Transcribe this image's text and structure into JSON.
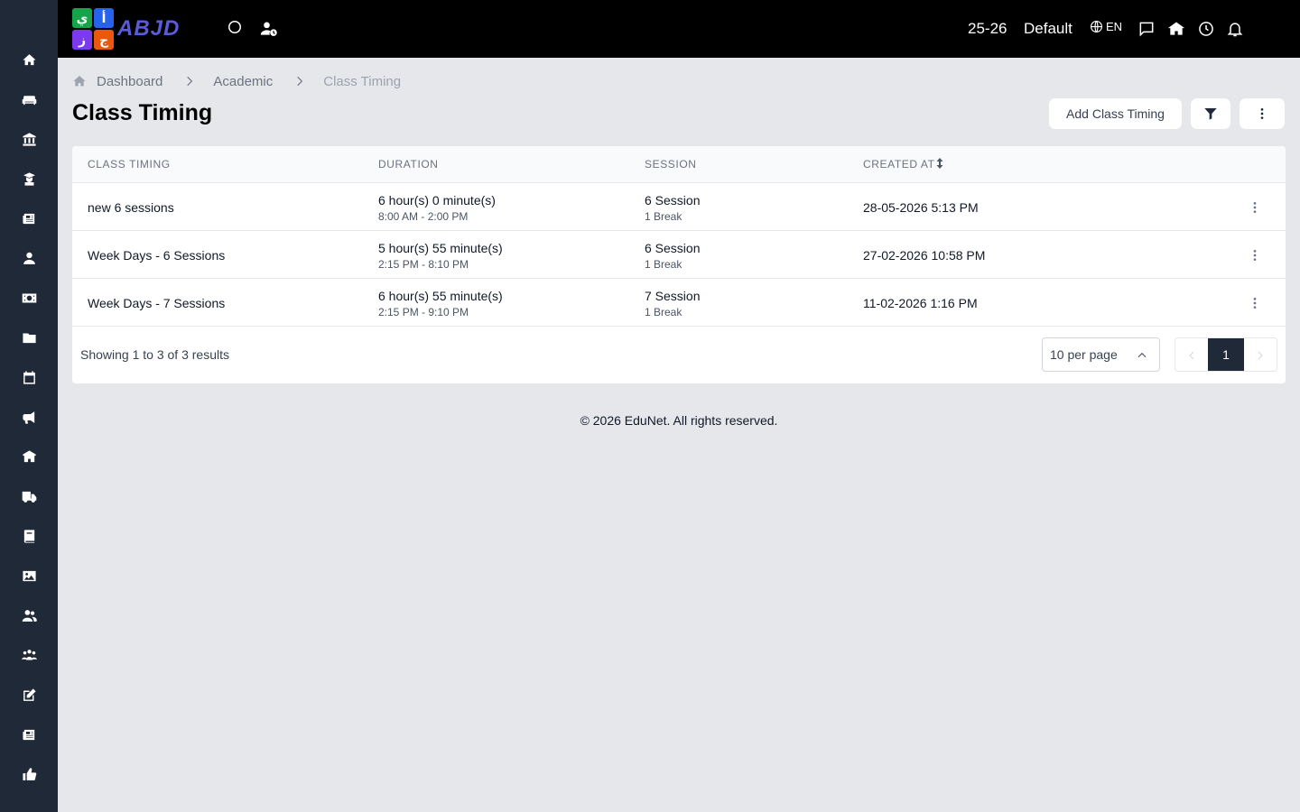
{
  "header": {
    "logo_letters": [
      "ي",
      "أ",
      "ز",
      "ج"
    ],
    "logo_colors": [
      "#16a34a",
      "#2563eb",
      "#7c3aed",
      "#ea580c"
    ],
    "logo_text": "ABJD",
    "session_year": "25-26",
    "school": "Default",
    "language": "EN",
    "icons": [
      "circle-icon",
      "user-clock-icon",
      "globe-icon",
      "chat-icon",
      "school-icon",
      "clock-icon",
      "bell-icon",
      "avatar"
    ]
  },
  "sidebar": {
    "icons": [
      "home-icon",
      "sofa-icon",
      "bank-icon",
      "graduate-icon",
      "newspaper-icon",
      "user-icon",
      "money-icon",
      "folder-icon",
      "calendar-icon",
      "megaphone-icon",
      "school-money-icon",
      "truck-icon",
      "book-icon",
      "image-icon",
      "users-icon",
      "group-icon",
      "edit-icon",
      "news-icon",
      "thumbs-up-icon"
    ]
  },
  "breadcrumb": {
    "items": [
      "Dashboard",
      "Academic"
    ],
    "current": "Class Timing"
  },
  "page": {
    "title": "Class Timing",
    "add_button": "Add Class Timing"
  },
  "table": {
    "headers": {
      "name": "CLASS TIMING",
      "duration": "DURATION",
      "session": "SESSION",
      "created": "CREATED AT"
    },
    "rows": [
      {
        "name": "new 6 sessions",
        "duration": "6 hour(s) 0 minute(s)",
        "range": "8:00 AM - 2:00 PM",
        "session": "6 Session",
        "break": "1 Break",
        "created": "28-05-2026 5:13 PM"
      },
      {
        "name": "Week Days - 6 Sessions",
        "duration": "5 hour(s) 55 minute(s)",
        "range": "2:15 PM - 8:10 PM",
        "session": "6 Session",
        "break": "1 Break",
        "created": "27-02-2026 10:58 PM"
      },
      {
        "name": "Week Days - 7 Sessions",
        "duration": "6 hour(s) 55 minute(s)",
        "range": "2:15 PM - 9:10 PM",
        "session": "7 Session",
        "break": "1 Break",
        "created": "11-02-2026 1:16 PM"
      }
    ]
  },
  "pagination": {
    "summary": "Showing 1 to 3 of 3 results",
    "per_page": "10 per page",
    "current_page": "1"
  },
  "footer": {
    "text": "© 2026 EduNet. All rights reserved."
  }
}
